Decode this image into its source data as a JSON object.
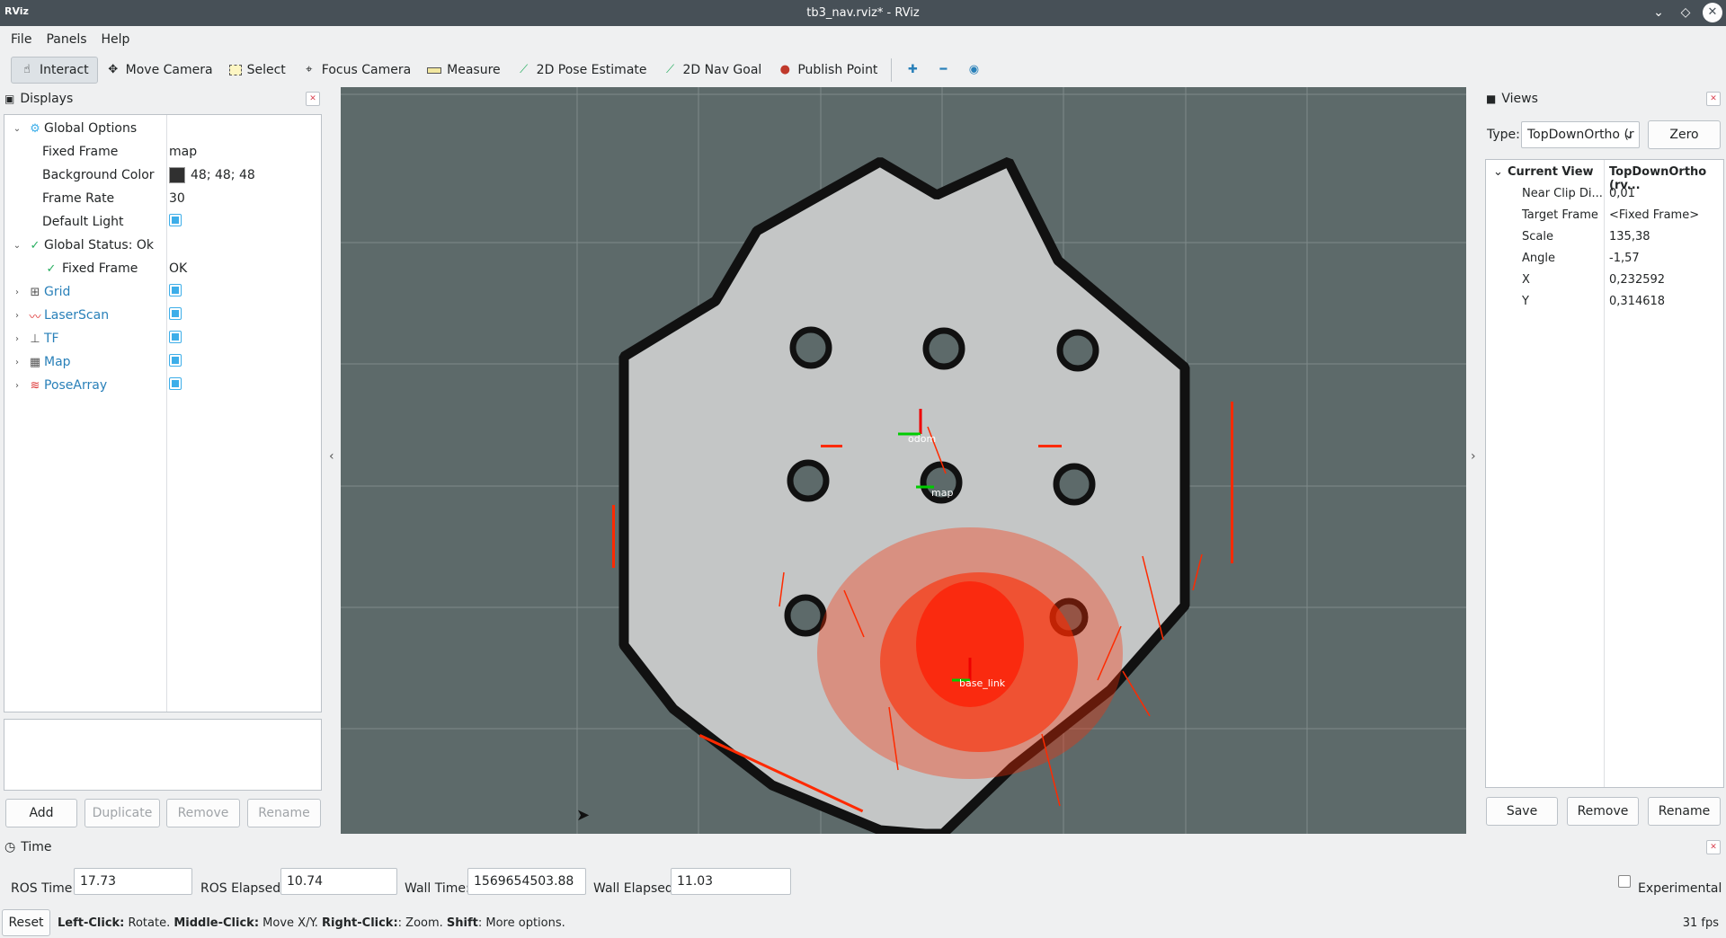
{
  "window": {
    "logo": "RViz",
    "title": "tb3_nav.rviz* - RViz"
  },
  "menu": [
    "File",
    "Panels",
    "Help"
  ],
  "toolbar": {
    "tools": [
      {
        "label": "Interact",
        "icon": "hand-pointer-icon",
        "active": true
      },
      {
        "label": "Move Camera",
        "icon": "move-camera-icon"
      },
      {
        "label": "Select",
        "icon": "select-box-icon"
      },
      {
        "label": "Focus Camera",
        "icon": "focus-camera-icon"
      },
      {
        "label": "Measure",
        "icon": "measure-ruler-icon"
      },
      {
        "label": "2D Pose Estimate",
        "icon": "pose-arrow-icon"
      },
      {
        "label": "2D Nav Goal",
        "icon": "nav-goal-arrow-icon"
      },
      {
        "label": "Publish Point",
        "icon": "map-pin-icon"
      }
    ]
  },
  "displays": {
    "title": "Displays",
    "rows": [
      {
        "label": "Global Options",
        "value": "",
        "expand": "open",
        "icon": "gear-icon",
        "indent": 0,
        "type": "text"
      },
      {
        "label": "Fixed Frame",
        "value": "map",
        "indent": 1,
        "type": "text"
      },
      {
        "label": "Background Color",
        "value": "48; 48; 48",
        "swatch": "#303030",
        "indent": 1,
        "type": "color"
      },
      {
        "label": "Frame Rate",
        "value": "30",
        "indent": 1,
        "type": "text"
      },
      {
        "label": "Default Light",
        "value": "",
        "indent": 1,
        "type": "check"
      },
      {
        "label": "Global Status: Ok",
        "value": "",
        "expand": "open",
        "icon": "checkmark-icon",
        "indent": 0,
        "type": "text"
      },
      {
        "label": "Fixed Frame",
        "value": "OK",
        "icon": "checkmark-icon",
        "indent": 1,
        "type": "text"
      },
      {
        "label": "Grid",
        "value": "",
        "expand": "closed",
        "icon": "grid-icon",
        "indent": 0,
        "type": "check",
        "blue": true
      },
      {
        "label": "LaserScan",
        "value": "",
        "expand": "closed",
        "icon": "laserscan-icon",
        "indent": 0,
        "type": "check",
        "blue": true
      },
      {
        "label": "TF",
        "value": "",
        "expand": "closed",
        "icon": "tf-axes-icon",
        "indent": 0,
        "type": "check",
        "blue": true
      },
      {
        "label": "Map",
        "value": "",
        "expand": "closed",
        "icon": "map-icon",
        "indent": 0,
        "type": "check",
        "blue": true
      },
      {
        "label": "PoseArray",
        "value": "",
        "expand": "closed",
        "icon": "posearray-icon",
        "indent": 0,
        "type": "check",
        "blue": true
      }
    ],
    "buttons": [
      "Add",
      "Duplicate",
      "Remove",
      "Rename"
    ]
  },
  "views": {
    "title": "Views",
    "type_label": "Type:",
    "type_value": "TopDownOrtho (r",
    "zero_label": "Zero",
    "rows": [
      {
        "label": "Current View",
        "value": "TopDownOrtho (rv..."
      },
      {
        "label": "Near Clip Di...",
        "value": "0,01"
      },
      {
        "label": "Target Frame",
        "value": "<Fixed Frame>"
      },
      {
        "label": "Scale",
        "value": "135,38"
      },
      {
        "label": "Angle",
        "value": "-1,57"
      },
      {
        "label": "X",
        "value": "0,232592"
      },
      {
        "label": "Y",
        "value": "0,314618"
      }
    ],
    "buttons": [
      "Save",
      "Remove",
      "Rename"
    ]
  },
  "viewport": {
    "frame_labels": [
      "odom",
      "map",
      "base_link"
    ]
  },
  "time": {
    "title": "Time",
    "ros_time_label": "ROS Time:",
    "ros_time": "17.73",
    "ros_elapsed_label": "ROS Elapsed:",
    "ros_elapsed": "10.74",
    "wall_time_label": "Wall Time:",
    "wall_time": "1569654503.88",
    "wall_elapsed_label": "Wall Elapsed:",
    "wall_elapsed": "11.03",
    "experimental_label": "Experimental"
  },
  "status": {
    "reset_label": "Reset",
    "left_click": "Left-Click:",
    "left_desc": " Rotate. ",
    "middle_click": "Middle-Click:",
    "middle_desc": " Move X/Y. ",
    "right_click": "Right-Click:",
    "right_desc": ": Zoom. ",
    "shift": "Shift",
    "shift_desc": ": More options.",
    "fps": "31 fps"
  }
}
